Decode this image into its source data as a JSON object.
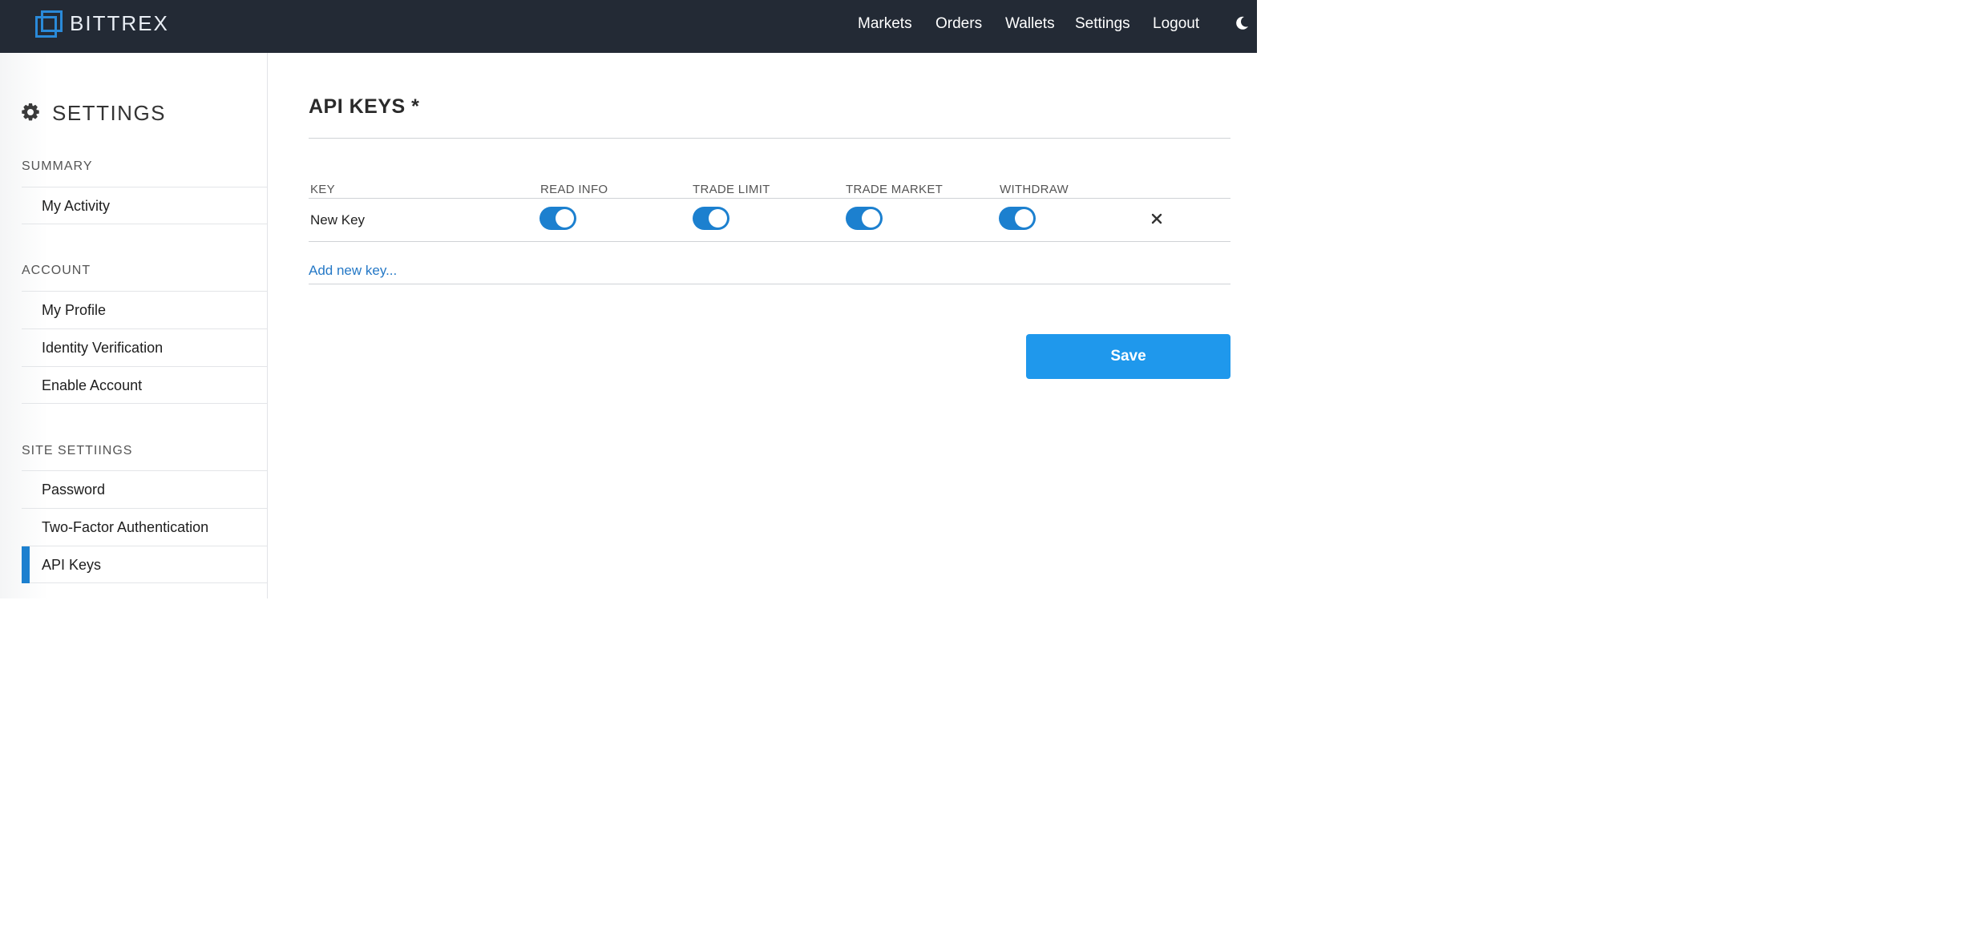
{
  "brand": {
    "name": "BITTREX"
  },
  "nav": {
    "items": [
      "Markets",
      "Orders",
      "Wallets",
      "Settings",
      "Logout"
    ],
    "theme_icon": "moon-icon"
  },
  "sidebar": {
    "title": "SETTINGS",
    "sections": [
      {
        "heading": "SUMMARY",
        "items": [
          "My Activity"
        ]
      },
      {
        "heading": "ACCOUNT",
        "items": [
          "My Profile",
          "Identity Verification",
          "Enable Account"
        ]
      },
      {
        "heading": "SITE SETTIINGS",
        "items": [
          "Password",
          "Two-Factor Authentication",
          "API Keys"
        ]
      }
    ],
    "active_item": "API Keys"
  },
  "main": {
    "title": "API KEYS *",
    "columns": [
      "KEY",
      "READ INFO",
      "TRADE LIMIT",
      "TRADE MARKET",
      "WITHDRAW"
    ],
    "rows": [
      {
        "key": "New Key",
        "read_info": true,
        "trade_limit": true,
        "trade_market": true,
        "withdraw": true
      }
    ],
    "add_key_label": "Add new key...",
    "save_label": "Save"
  },
  "colors": {
    "topbar": "#232a35",
    "accent": "#1c80cf",
    "save_button": "#1f98ec",
    "link": "#2478c6"
  }
}
